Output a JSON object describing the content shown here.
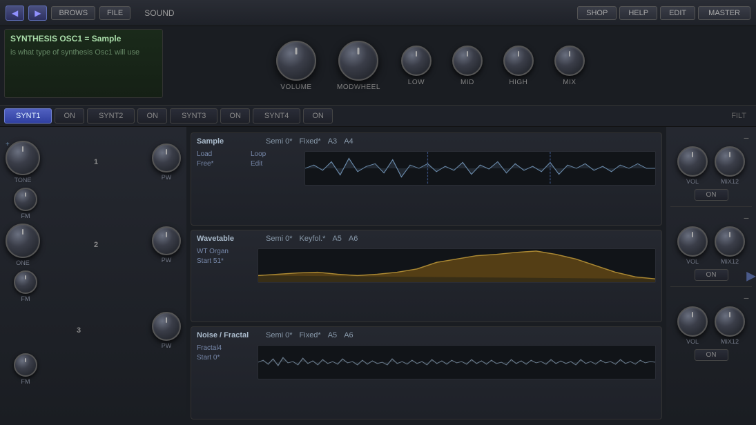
{
  "topbar": {
    "back_arrow": "◀",
    "forward_arrow": "▶",
    "brows_label": "BROWS",
    "file_label": "FILE",
    "sound_label": "SOUND",
    "shop_label": "SHOP",
    "help_label": "HELP",
    "edit_label": "EDIT",
    "master_label": "MASTER"
  },
  "info": {
    "title": "SYNTHESIS OSC1 = Sample",
    "description": "is what type of synthesis Osc1 will use"
  },
  "knobs_top": [
    {
      "label": "VOLUME",
      "size": "large"
    },
    {
      "label": "MODWHEEL",
      "size": "large"
    },
    {
      "label": "LOW",
      "size": "medium"
    },
    {
      "label": "MID",
      "size": "medium"
    },
    {
      "label": "HIGH",
      "size": "medium"
    },
    {
      "label": "MIX",
      "size": "medium"
    }
  ],
  "synth_tabs": [
    {
      "label": "SYNT1",
      "active": true
    },
    {
      "label": "ON",
      "active": false
    },
    {
      "label": "SYNT2",
      "active": false
    },
    {
      "label": "ON",
      "active": false
    },
    {
      "label": "SYNT3",
      "active": false
    },
    {
      "label": "ON",
      "active": false
    },
    {
      "label": "SYNT4",
      "active": false
    },
    {
      "label": "ON",
      "active": false
    },
    {
      "label": "FILT",
      "active": false
    }
  ],
  "oscillators": [
    {
      "type": "Sample",
      "semi": "Semi 0*",
      "keyfol": "Fixed*",
      "note1": "A3",
      "note2": "A4",
      "sub1": "Load",
      "sub2": "Loop",
      "sub3": "Free*",
      "sub4": "Edit",
      "waveform_type": "sample"
    },
    {
      "type": "Wavetable",
      "semi": "Semi 0*",
      "keyfol": "Keyfol.*",
      "note1": "A5",
      "note2": "A6",
      "sub1": "WT Organ",
      "sub2": "Start 51*",
      "waveform_type": "wavetable"
    },
    {
      "type": "Noise / Fractal",
      "semi": "Semi 0*",
      "keyfol": "Fixed*",
      "note1": "A5",
      "note2": "A6",
      "sub1": "Fractal4",
      "sub2": "Start 0*",
      "waveform_type": "noise"
    }
  ],
  "left_panel": {
    "rows": [
      {
        "number": "1",
        "tone_label": "TONE",
        "fm_label": "FM",
        "pw_label": "PW"
      },
      {
        "number": "2",
        "tone_label": "ONE",
        "fm_label": "FM",
        "pw_label": "PW"
      },
      {
        "number": "3",
        "fm_label": "FM",
        "pw_label": "PW"
      }
    ]
  },
  "right_panel": {
    "sections": [
      {
        "vol_label": "VOL",
        "mix_label": "MIX12",
        "on_label": "ON"
      },
      {
        "vol_label": "VOL",
        "mix_label": "MIX12",
        "on_label": "ON"
      },
      {
        "vol_label": "VOL",
        "mix_label": "MIX12",
        "on_label": "ON"
      }
    ]
  }
}
